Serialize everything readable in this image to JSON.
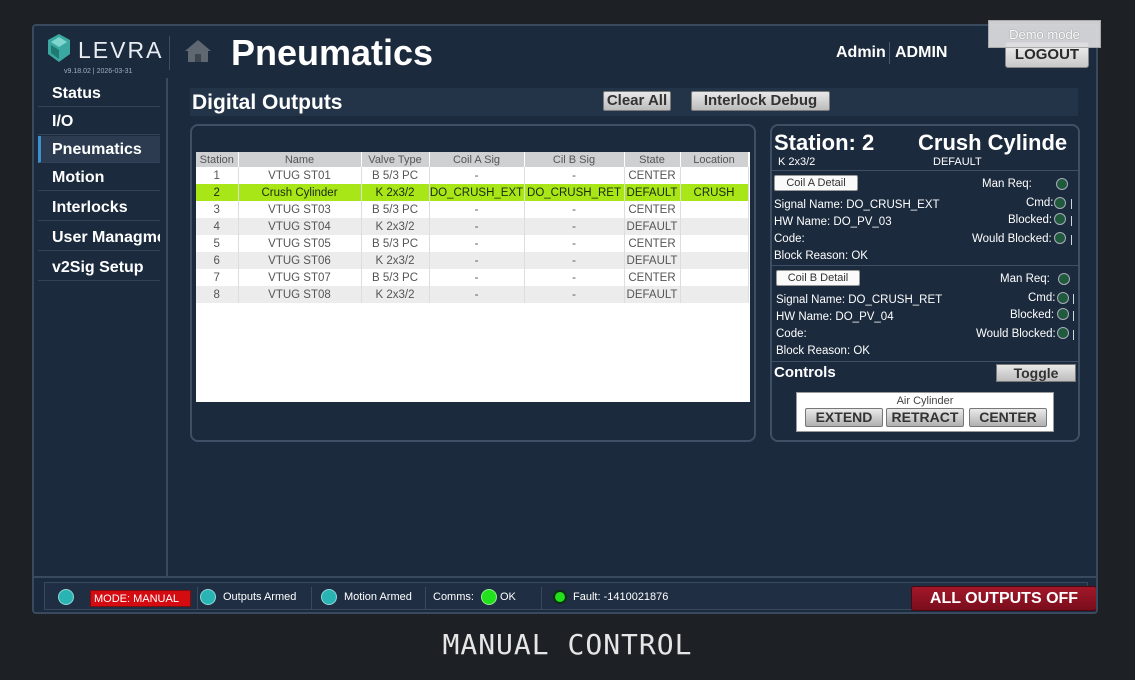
{
  "header": {
    "brand": "LEVRA",
    "version": "v9.18.02 | 2026-03-31",
    "title": "Pneumatics",
    "user_name": "Admin",
    "user_role": "ADMIN",
    "logout_label": "LOGOUT",
    "demo_badge": "Demo mode"
  },
  "sidebar": {
    "items": [
      {
        "label": "Status"
      },
      {
        "label": "I/O"
      },
      {
        "label": "Pneumatics"
      },
      {
        "label": "Motion"
      },
      {
        "label": "Interlocks"
      },
      {
        "label": "User Managment"
      },
      {
        "label": "v2Sig Setup"
      }
    ],
    "active": "Pneumatics"
  },
  "main": {
    "section_title": "Digital Outputs",
    "clear_all_label": "Clear All",
    "interlock_debug_label": "Interlock Debug",
    "table": {
      "columns": [
        "Station",
        "Name",
        "Valve Type",
        "Coil A Sig",
        "Cil B Sig",
        "State",
        "Location"
      ],
      "rows": [
        [
          "1",
          "VTUG ST01",
          "B 5/3 PC",
          "-",
          "-",
          "CENTER",
          ""
        ],
        [
          "2",
          "Crush Cylinder",
          "K 2x3/2",
          "DO_CRUSH_EXT",
          "DO_CRUSH_RET",
          "DEFAULT",
          "CRUSH"
        ],
        [
          "3",
          "VTUG ST03",
          "B 5/3 PC",
          "-",
          "-",
          "CENTER",
          ""
        ],
        [
          "4",
          "VTUG ST04",
          "K 2x3/2",
          "-",
          "-",
          "DEFAULT",
          ""
        ],
        [
          "5",
          "VTUG ST05",
          "B 5/3 PC",
          "-",
          "-",
          "CENTER",
          ""
        ],
        [
          "6",
          "VTUG ST06",
          "K 2x3/2",
          "-",
          "-",
          "DEFAULT",
          ""
        ],
        [
          "7",
          "VTUG ST07",
          "B 5/3 PC",
          "-",
          "-",
          "CENTER",
          ""
        ],
        [
          "8",
          "VTUG ST08",
          "K 2x3/2",
          "-",
          "-",
          "DEFAULT",
          ""
        ]
      ],
      "selected_row": 2
    }
  },
  "station": {
    "title": "Station: 2",
    "name": "Crush Cylinder",
    "valve_type": "K 2x3/2",
    "state": "DEFAULT",
    "coil_a": {
      "button": "Coil A Detail",
      "signal_name": "Signal Name: DO_CRUSH_EXT",
      "hw_name": "HW Name: DO_PV_03",
      "code": "Code:",
      "block_reason": "Block Reason: OK",
      "man_req": "Man Req:",
      "cmd": "Cmd:",
      "blocked": "Blocked:",
      "would_blocked": "Would Blocked:"
    },
    "coil_b": {
      "button": "Coil B Detail",
      "signal_name": "Signal Name: DO_CRUSH_RET",
      "hw_name": "HW Name: DO_PV_04",
      "code": "Code:",
      "block_reason": "Block Reason: OK",
      "man_req": "Man Req:",
      "cmd": "Cmd:",
      "blocked": "Blocked:",
      "would_blocked": "Would Blocked:"
    },
    "controls_label": "Controls",
    "toggle_label": "Toggle",
    "air_cylinder_label": "Air Cylinder",
    "extend_label": "EXTEND",
    "retract_label": "RETRACT",
    "center_label": "CENTER"
  },
  "status_bar": {
    "mode": "MODE: MANUAL",
    "outputs_armed": "Outputs Armed",
    "motion_armed": "Motion Armed",
    "comms_label": "Comms:",
    "comms_value": "OK",
    "fault": "Fault: -1410021876",
    "all_outputs_off": "ALL OUTPUTS OFF"
  },
  "caption": "MANUAL CONTROL",
  "colors": {
    "background": "#1b2a3d",
    "selected_row": "#a8e617",
    "mode_badge": "#d40c12",
    "all_off": "#8b1020",
    "indicator_teal": "#2ab3b3",
    "indicator_green": "#22e01c"
  }
}
